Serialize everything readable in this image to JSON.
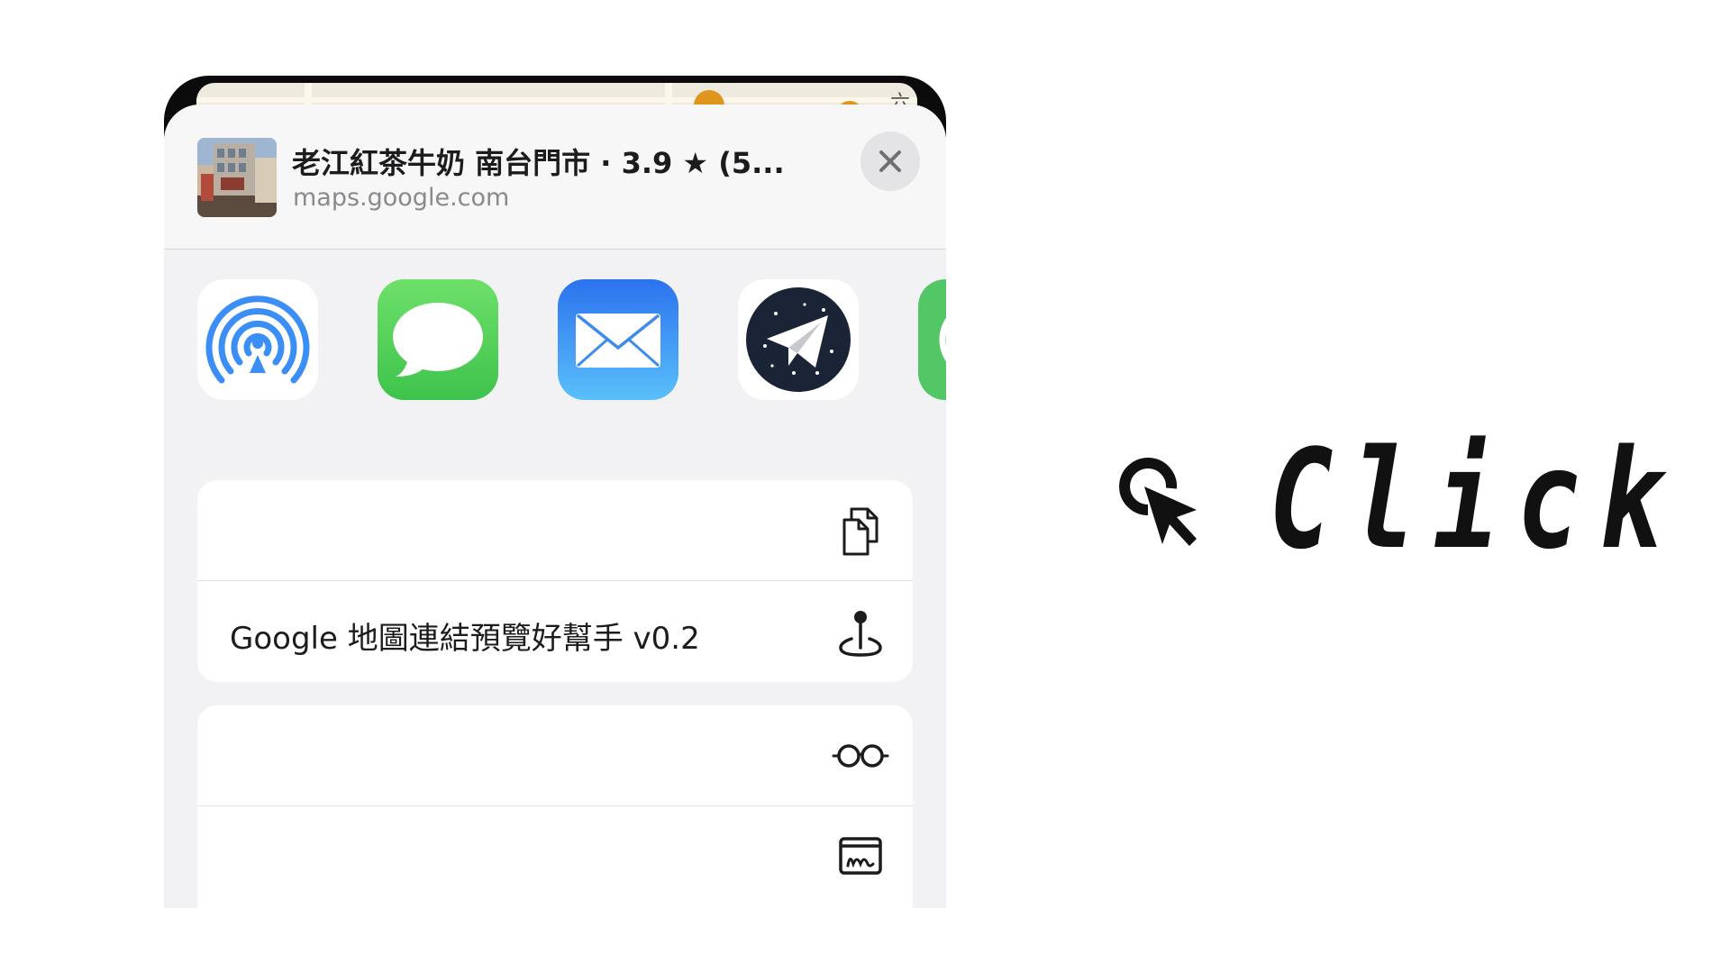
{
  "share_sheet": {
    "map_label": "六合",
    "title": "老江紅茶牛奶 南台門市 · 3.9 ★ (5...",
    "subtitle": "maps.google.com",
    "close_icon": "close-icon",
    "apps": [
      {
        "name": "airdrop",
        "icon": "airdrop-icon",
        "color": "#3a8ef6"
      },
      {
        "name": "messages",
        "icon": "messages-icon",
        "color": "#4cd964"
      },
      {
        "name": "mail",
        "icon": "mail-icon",
        "color": "#2f86f5"
      },
      {
        "name": "telegram-x",
        "icon": "telegram-icon",
        "color": "#1b2436"
      },
      {
        "name": "partial-app",
        "icon": "whatsapp-icon",
        "color": "#53c766"
      }
    ],
    "actions_group_1": [
      {
        "label": "",
        "icon": "copy-icon"
      },
      {
        "label": "Google 地圖連結預覽好幫手 v0.2",
        "icon": "map-pin-icon"
      }
    ],
    "actions_group_2": [
      {
        "label": "",
        "icon": "reading-glasses-icon"
      },
      {
        "label": "",
        "icon": "markup-icon"
      }
    ]
  },
  "click_graphic": {
    "text": "Click",
    "icon": "click-cursor-icon"
  }
}
